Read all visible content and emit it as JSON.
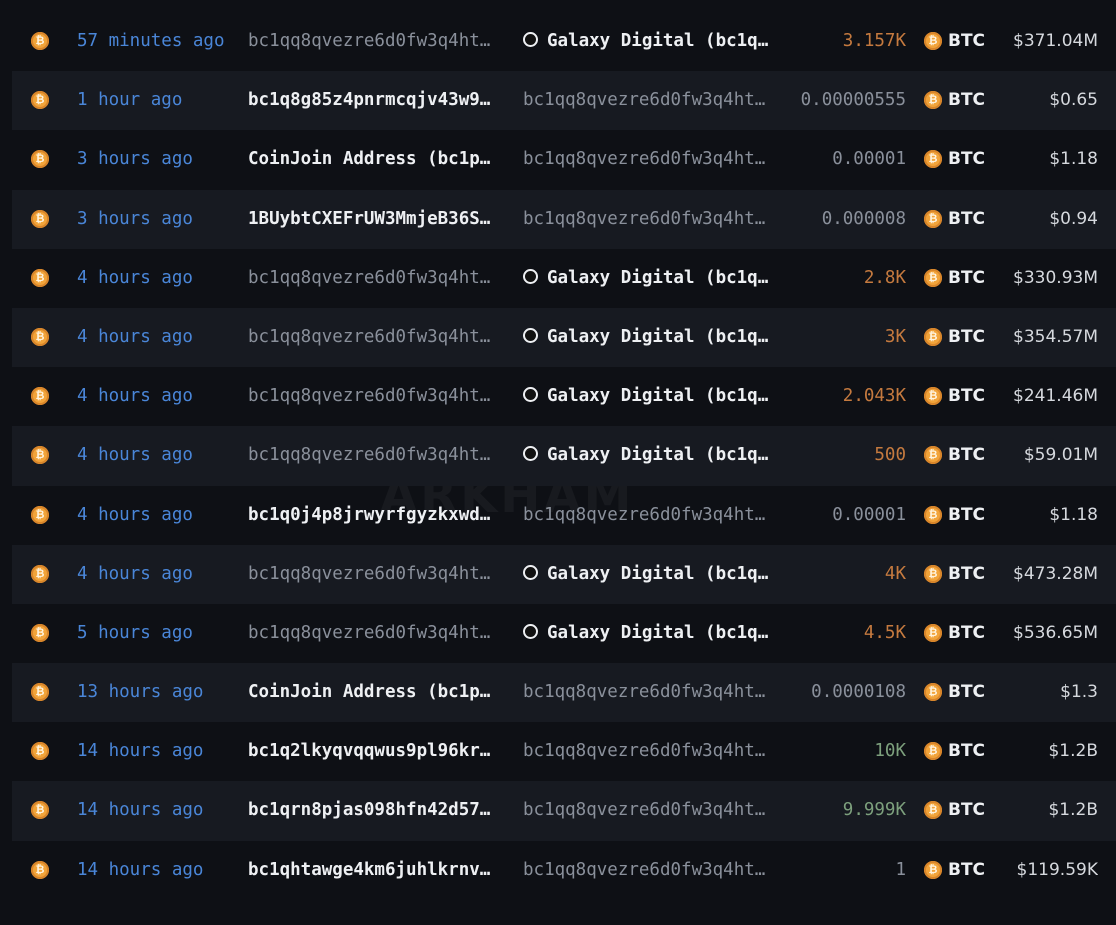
{
  "watermark": "ARKHAM",
  "colors": {
    "time_link": "#4a86d8",
    "amount_large": "#c57a3f",
    "coin": "#f2a43a"
  },
  "rows": [
    {
      "time": "57 minutes ago",
      "from": "bc1qq8qvezre6d0fw3q4ht…",
      "from_style": "dim",
      "to": "Galaxy Digital (bc1q…",
      "to_style": "entity",
      "amount": "3.157K",
      "amount_style": "big",
      "token": "BTC",
      "usd": "$371.04M"
    },
    {
      "time": "1 hour ago",
      "from": "bc1q8g85z4pnrmcqjv43w9…",
      "from_style": "bright",
      "to": "bc1qq8qvezre6d0fw3q4ht…",
      "to_style": "dim",
      "amount": "0.00000555",
      "amount_style": "small",
      "token": "BTC",
      "usd": "$0.65"
    },
    {
      "time": "3 hours ago",
      "from": "CoinJoin Address (bc1p…",
      "from_style": "bright",
      "to": "bc1qq8qvezre6d0fw3q4ht…",
      "to_style": "dim",
      "amount": "0.00001",
      "amount_style": "small",
      "token": "BTC",
      "usd": "$1.18"
    },
    {
      "time": "3 hours ago",
      "from": "1BUybtCXEFrUW3MmjeB36S…",
      "from_style": "bright",
      "to": "bc1qq8qvezre6d0fw3q4ht…",
      "to_style": "dim",
      "amount": "0.000008",
      "amount_style": "small",
      "token": "BTC",
      "usd": "$0.94"
    },
    {
      "time": "4 hours ago",
      "from": "bc1qq8qvezre6d0fw3q4ht…",
      "from_style": "dim",
      "to": "Galaxy Digital (bc1q…",
      "to_style": "entity",
      "amount": "2.8K",
      "amount_style": "big",
      "token": "BTC",
      "usd": "$330.93M"
    },
    {
      "time": "4 hours ago",
      "from": "bc1qq8qvezre6d0fw3q4ht…",
      "from_style": "dim",
      "to": "Galaxy Digital (bc1q…",
      "to_style": "entity",
      "amount": "3K",
      "amount_style": "big",
      "token": "BTC",
      "usd": "$354.57M"
    },
    {
      "time": "4 hours ago",
      "from": "bc1qq8qvezre6d0fw3q4ht…",
      "from_style": "dim",
      "to": "Galaxy Digital (bc1q…",
      "to_style": "entity",
      "amount": "2.043K",
      "amount_style": "big",
      "token": "BTC",
      "usd": "$241.46M"
    },
    {
      "time": "4 hours ago",
      "from": "bc1qq8qvezre6d0fw3q4ht…",
      "from_style": "dim",
      "to": "Galaxy Digital (bc1q…",
      "to_style": "entity",
      "amount": "500",
      "amount_style": "big",
      "token": "BTC",
      "usd": "$59.01M"
    },
    {
      "time": "4 hours ago",
      "from": "bc1q0j4p8jrwyrfgyzkxwd…",
      "from_style": "bright",
      "to": "bc1qq8qvezre6d0fw3q4ht…",
      "to_style": "dim",
      "amount": "0.00001",
      "amount_style": "small",
      "token": "BTC",
      "usd": "$1.18"
    },
    {
      "time": "4 hours ago",
      "from": "bc1qq8qvezre6d0fw3q4ht…",
      "from_style": "dim",
      "to": "Galaxy Digital (bc1q…",
      "to_style": "entity",
      "amount": "4K",
      "amount_style": "big",
      "token": "BTC",
      "usd": "$473.28M"
    },
    {
      "time": "5 hours ago",
      "from": "bc1qq8qvezre6d0fw3q4ht…",
      "from_style": "dim",
      "to": "Galaxy Digital (bc1q…",
      "to_style": "entity",
      "amount": "4.5K",
      "amount_style": "big",
      "token": "BTC",
      "usd": "$536.65M"
    },
    {
      "time": "13 hours ago",
      "from": "CoinJoin Address (bc1p…",
      "from_style": "bright",
      "to": "bc1qq8qvezre6d0fw3q4ht…",
      "to_style": "dim",
      "amount": "0.0000108",
      "amount_style": "small",
      "token": "BTC",
      "usd": "$1.3"
    },
    {
      "time": "14 hours ago",
      "from": "bc1q2lkyqvqqwus9pl96kr…",
      "from_style": "bright",
      "to": "bc1qq8qvezre6d0fw3q4ht…",
      "to_style": "dim",
      "amount": "10K",
      "amount_style": "green",
      "token": "BTC",
      "usd": "$1.2B"
    },
    {
      "time": "14 hours ago",
      "from": "bc1qrn8pjas098hfn42d57…",
      "from_style": "bright",
      "to": "bc1qq8qvezre6d0fw3q4ht…",
      "to_style": "dim",
      "amount": "9.999K",
      "amount_style": "green",
      "token": "BTC",
      "usd": "$1.2B"
    },
    {
      "time": "14 hours ago",
      "from": "bc1qhtawge4km6juhlkrnv…",
      "from_style": "bright",
      "to": "bc1qq8qvezre6d0fw3q4ht…",
      "to_style": "dim",
      "amount": "1",
      "amount_style": "small",
      "token": "BTC",
      "usd": "$119.59K"
    }
  ]
}
